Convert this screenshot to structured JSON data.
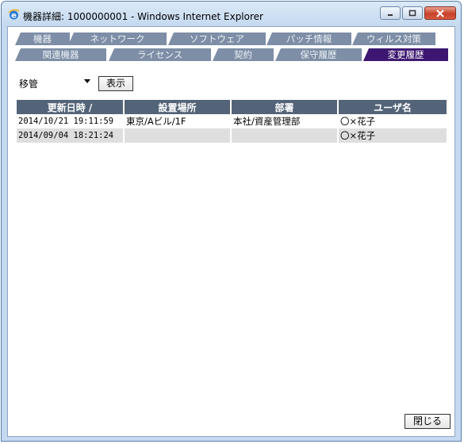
{
  "window": {
    "title": "機器詳細: 1000000001 - Windows Internet Explorer",
    "icon": "ie-icon"
  },
  "tabs_top": [
    {
      "label": "機器"
    },
    {
      "label": "ネットワーク"
    },
    {
      "label": "ソフトウェア"
    },
    {
      "label": "パッチ情報"
    },
    {
      "label": "ウィルス対策"
    }
  ],
  "tabs_bottom": [
    {
      "label": "関連機器"
    },
    {
      "label": "ライセンス"
    },
    {
      "label": "契約"
    },
    {
      "label": "保守履歴"
    },
    {
      "label": "変更履歴",
      "active": true
    }
  ],
  "filter": {
    "selected": "移管",
    "show_label": "表示"
  },
  "table": {
    "headers": [
      "更新日時 /",
      "設置場所",
      "部署",
      "ユーザ名"
    ],
    "rows": [
      [
        "2014/10/21 19:11:59",
        "東京/Aビル/1F",
        "本社/資産管理部",
        "〇×花子"
      ],
      [
        "2014/09/04 18:21:24",
        "",
        "",
        "〇×花子"
      ]
    ]
  },
  "footer": {
    "close_label": "閉じる"
  },
  "colors": {
    "tab": "#7d8ea6",
    "tab_active": "#3c1670",
    "header": "#536478",
    "row_alt": "#dedede"
  }
}
